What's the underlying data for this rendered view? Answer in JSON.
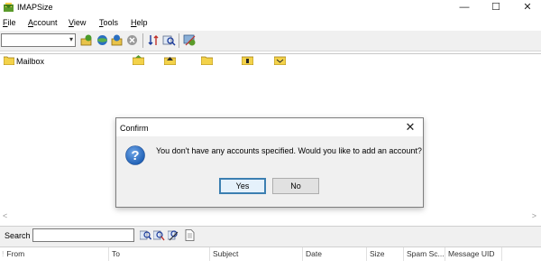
{
  "window": {
    "title": "IMAPSize",
    "minimize_glyph": "—",
    "maximize_glyph": "☐",
    "close_glyph": "✕"
  },
  "menu": [
    {
      "label": "File",
      "mnemonic": "F",
      "rest": "ile"
    },
    {
      "label": "Account",
      "mnemonic": "A",
      "rest": "ccount"
    },
    {
      "label": "View",
      "mnemonic": "V",
      "rest": "iew"
    },
    {
      "label": "Tools",
      "mnemonic": "T",
      "rest": "ools"
    },
    {
      "label": "Help",
      "mnemonic": "H",
      "rest": "elp"
    }
  ],
  "toolbar": {
    "account_combo_value": "",
    "icons": [
      "connect-icon",
      "add-account-icon",
      "download-icon",
      "stop-icon",
      "sort-icon",
      "search-mail-icon",
      "settings-icon"
    ]
  },
  "mailbox": {
    "root_label": "Mailbox",
    "column_icons": [
      "inbox-icon",
      "home-icon",
      "folder-icon",
      "attachment-icon",
      "mail-icon"
    ]
  },
  "search": {
    "label": "Search",
    "value": ""
  },
  "message_list": {
    "columns": [
      "From",
      "To",
      "Subject",
      "Date",
      "Size",
      "Spam Sc...",
      "Message UID"
    ]
  },
  "dialog": {
    "title": "Confirm",
    "close_glyph": "✕",
    "message": "You don't have any accounts specified. Would you like to add an account?",
    "icon": "question-icon",
    "buttons": {
      "yes": "Yes",
      "no": "No"
    }
  },
  "colors": {
    "dialog_bg": "#f0f0f0",
    "default_button_border": "#3c7fb1",
    "question_icon": "#1e5fb4"
  }
}
